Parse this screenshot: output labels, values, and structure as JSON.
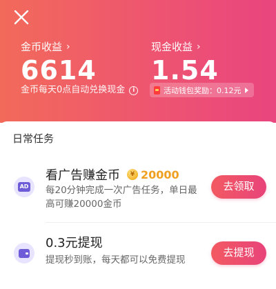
{
  "header": {
    "close_icon": "close-icon",
    "gold": {
      "label": "金币收益",
      "chevron": "›",
      "value": "6614"
    },
    "cash": {
      "label": "现金收益",
      "chevron": "›",
      "value": "1.54"
    },
    "gold_note": "金币每天0点自动兑换现金",
    "info_icon_glyph": "i",
    "activity_text": "活动钱包奖励：0.12元"
  },
  "section": {
    "title": "日常任务"
  },
  "tasks": [
    {
      "icon": "ad-icon",
      "icon_text": "AD",
      "title": "看广告赚金币",
      "reward_icon_glyph": "¥",
      "reward": "20000",
      "description": "每20分钟完成一次广告任务，单日最高可赚20000金币",
      "button": "去领取"
    },
    {
      "icon": "wallet-icon",
      "title": "0.3元提现",
      "description": "提现秒到账，每天都可以免费提现",
      "button": "去提现"
    }
  ],
  "colors": {
    "header_gradient_start": "#f26a5a",
    "header_gradient_end": "#e9457f",
    "reward_gold": "#f0a020",
    "icon_purple": "#6d5bd8",
    "button_pink": "#e8437a"
  }
}
